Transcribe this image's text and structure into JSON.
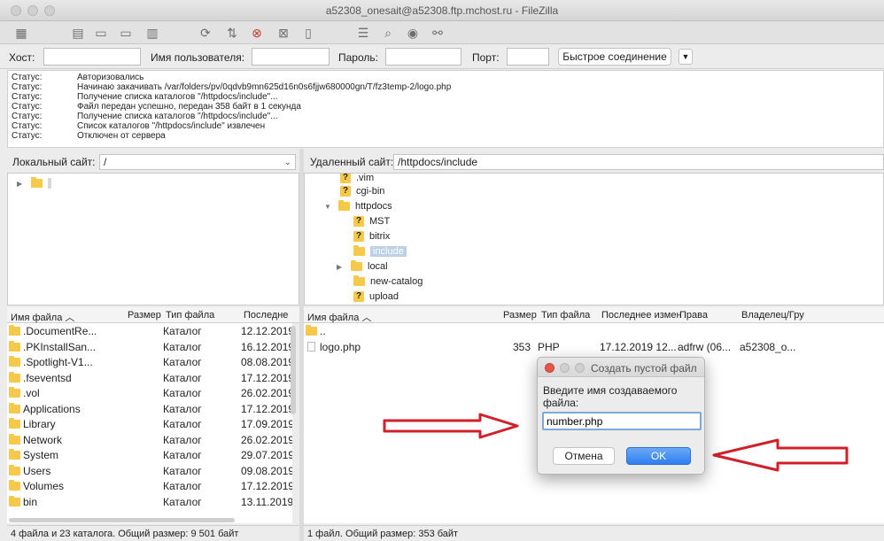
{
  "window": {
    "title": "a52308_onesait@a52308.ftp.mchost.ru - FileZilla"
  },
  "quickconnect": {
    "host_label": "Хост:",
    "user_label": "Имя пользователя:",
    "pass_label": "Пароль:",
    "port_label": "Порт:",
    "connect_label": "Быстрое соединение"
  },
  "log": [
    {
      "key": "Статус:",
      "msg": "Авторизовались"
    },
    {
      "key": "Статус:",
      "msg": "Начинаю закачивать /var/folders/pv/0qdvb9mn625d16n0s6fjjw680000gn/T/fz3temp-2/logo.php"
    },
    {
      "key": "Статус:",
      "msg": "Получение списка каталогов \"/httpdocs/include\"..."
    },
    {
      "key": "Статус:",
      "msg": "Файл передан успешно, передан 358 байт в 1 секунда"
    },
    {
      "key": "Статус:",
      "msg": "Получение списка каталогов \"/httpdocs/include\"..."
    },
    {
      "key": "Статус:",
      "msg": "Список каталогов \"/httpdocs/include\" извлечен"
    },
    {
      "key": "Статус:",
      "msg": "Отключен от сервера"
    }
  ],
  "local": {
    "site_label": "Локальный сайт:",
    "path": "/",
    "headers": {
      "name": "Имя файла",
      "size": "Размер",
      "type": "Тип файла",
      "modified": "Последне"
    },
    "rows": [
      {
        "name": ".DocumentRe...",
        "type": "Каталог",
        "date": "12.12.2019"
      },
      {
        "name": ".PKInstallSan...",
        "type": "Каталог",
        "date": "16.12.2019"
      },
      {
        "name": ".Spotlight-V1...",
        "type": "Каталог",
        "date": "08.08.2019"
      },
      {
        "name": ".fseventsd",
        "type": "Каталог",
        "date": "17.12.2019"
      },
      {
        "name": ".vol",
        "type": "Каталог",
        "date": "26.02.2019"
      },
      {
        "name": "Applications",
        "type": "Каталог",
        "date": "17.12.2019"
      },
      {
        "name": "Library",
        "type": "Каталог",
        "date": "17.09.2019"
      },
      {
        "name": "Network",
        "type": "Каталог",
        "date": "26.02.2019"
      },
      {
        "name": "System",
        "type": "Каталог",
        "date": "29.07.2019"
      },
      {
        "name": "Users",
        "type": "Каталог",
        "date": "09.08.2019"
      },
      {
        "name": "Volumes",
        "type": "Каталог",
        "date": "17.12.2019"
      },
      {
        "name": "bin",
        "type": "Каталог",
        "date": "13.11.2019"
      }
    ],
    "status": "4 файла и 23 каталога. Общий размер: 9 501 байт"
  },
  "remote": {
    "site_label": "Удаленный сайт:",
    "path": "/httpdocs/include",
    "tree": [
      {
        "label": ".vim",
        "icon": "question-folder-icon"
      },
      {
        "label": "cgi-bin",
        "icon": "question-folder-icon"
      },
      {
        "label": "httpdocs",
        "icon": "folder-icon"
      },
      {
        "label": "MST",
        "icon": "question-folder-icon"
      },
      {
        "label": "bitrix",
        "icon": "question-folder-icon"
      },
      {
        "label": "include",
        "icon": "folder-icon"
      },
      {
        "label": "local",
        "icon": "folder-icon"
      },
      {
        "label": "new-catalog",
        "icon": "folder-icon"
      },
      {
        "label": "upload",
        "icon": "question-folder-icon"
      }
    ],
    "headers": {
      "name": "Имя файла",
      "size": "Размер",
      "type": "Тип файла",
      "modified": "Последнее измен",
      "perms": "Права",
      "owner": "Владелец/Гру"
    },
    "rows": [
      {
        "name": "..",
        "size": "",
        "type": "",
        "date": "",
        "perms": "",
        "owner": ""
      },
      {
        "name": "logo.php",
        "size": "353",
        "type": "PHP",
        "date": "17.12.2019 12...",
        "perms": "adfrw (06...",
        "owner": "a52308_o..."
      }
    ],
    "status": "1 файл. Общий размер: 353 байт"
  },
  "dialog": {
    "title": "Создать пустой файл",
    "prompt": "Введите имя создаваемого файла:",
    "value": "number.php",
    "cancel_label": "Отмена",
    "ok_label": "OK"
  },
  "colors": {
    "accent": "#3b82f0",
    "arrow": "#d0202a",
    "folder": "#f7c94a"
  }
}
